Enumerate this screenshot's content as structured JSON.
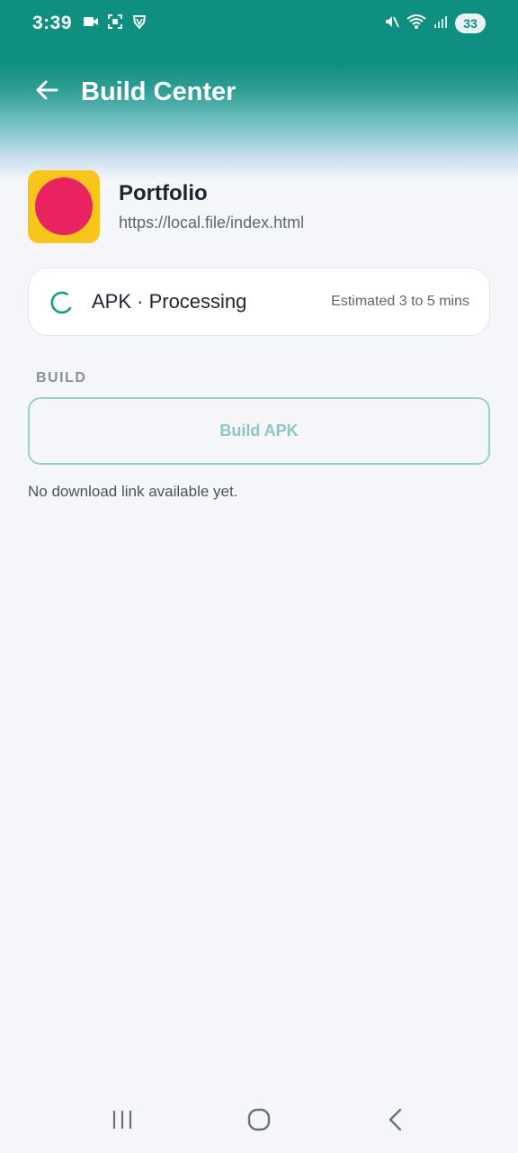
{
  "status_bar": {
    "time": "3:39",
    "battery": "33",
    "left_icons": [
      "video-camera-icon",
      "screen-record-icon",
      "vpn-shield-icon"
    ],
    "right_icons": [
      "mute-icon",
      "wifi-icon",
      "signal-icon",
      "battery-icon"
    ]
  },
  "app_bar": {
    "title": "Build Center",
    "back_icon": "arrow-left-icon"
  },
  "app": {
    "name": "Portfolio",
    "url": "https://local.file/index.html",
    "icon_colors": {
      "background": "#f8c51d",
      "dot": "#e8235f"
    }
  },
  "status_card": {
    "label": "APK · Processing",
    "estimate": "Estimated 3 to 5 mins",
    "spinner_color": "#1a9a8c"
  },
  "build": {
    "section_label": "BUILD",
    "button_label": "Build APK",
    "download_note": "No download link available yet."
  },
  "colors": {
    "accent": "#0f8f7f",
    "background": "#f4f6fa"
  },
  "nav_bar": {
    "icons": [
      "recent-apps-icon",
      "home-icon",
      "back-icon"
    ]
  }
}
